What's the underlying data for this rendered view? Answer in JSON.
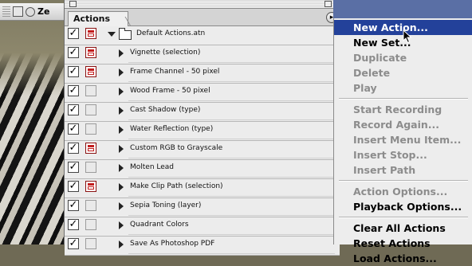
{
  "document_tab": {
    "title": "Ze"
  },
  "palette": {
    "tab_label": "Actions",
    "menu_button_icon": "palette-menu-arrow-icon",
    "rows": [
      {
        "kind": "set",
        "label": "Default Actions.atn",
        "checked": true,
        "dialog": true
      },
      {
        "kind": "action",
        "label": "Vignette (selection)",
        "checked": true,
        "dialog": true
      },
      {
        "kind": "action",
        "label": "Frame Channel - 50 pixel",
        "checked": true,
        "dialog": true
      },
      {
        "kind": "action",
        "label": "Wood Frame - 50 pixel",
        "checked": true,
        "dialog": false
      },
      {
        "kind": "action",
        "label": "Cast Shadow (type)",
        "checked": true,
        "dialog": false
      },
      {
        "kind": "action",
        "label": "Water Reflection (type)",
        "checked": true,
        "dialog": false
      },
      {
        "kind": "action",
        "label": "Custom RGB to Grayscale",
        "checked": true,
        "dialog": true
      },
      {
        "kind": "action",
        "label": "Molten Lead",
        "checked": true,
        "dialog": false
      },
      {
        "kind": "action",
        "label": "Make Clip Path (selection)",
        "checked": true,
        "dialog": true
      },
      {
        "kind": "action",
        "label": "Sepia Toning (layer)",
        "checked": true,
        "dialog": false
      },
      {
        "kind": "action",
        "label": "Quadrant Colors",
        "checked": true,
        "dialog": false
      },
      {
        "kind": "action",
        "label": "Save As Photoshop PDF",
        "checked": true,
        "dialog": false
      }
    ]
  },
  "palette_menu": {
    "groups": [
      [
        {
          "label": "New Action...",
          "state": "highlighted"
        },
        {
          "label": "New Set...",
          "state": "enabled"
        },
        {
          "label": "Duplicate",
          "state": "disabled"
        },
        {
          "label": "Delete",
          "state": "disabled"
        },
        {
          "label": "Play",
          "state": "disabled"
        }
      ],
      [
        {
          "label": "Start Recording",
          "state": "disabled"
        },
        {
          "label": "Record Again...",
          "state": "disabled"
        },
        {
          "label": "Insert Menu Item...",
          "state": "disabled"
        },
        {
          "label": "Insert Stop...",
          "state": "disabled"
        },
        {
          "label": "Insert Path",
          "state": "disabled"
        }
      ],
      [
        {
          "label": "Action Options...",
          "state": "disabled"
        },
        {
          "label": "Playback Options...",
          "state": "enabled"
        }
      ],
      [
        {
          "label": "Clear All Actions",
          "state": "enabled"
        },
        {
          "label": "Reset Actions",
          "state": "enabled"
        },
        {
          "label": "Load Actions...",
          "state": "enabled"
        }
      ]
    ]
  },
  "colors": {
    "highlight": "#23419a",
    "disabled_text": "#8c8c8c",
    "dialog_red": "#c21c1c"
  }
}
